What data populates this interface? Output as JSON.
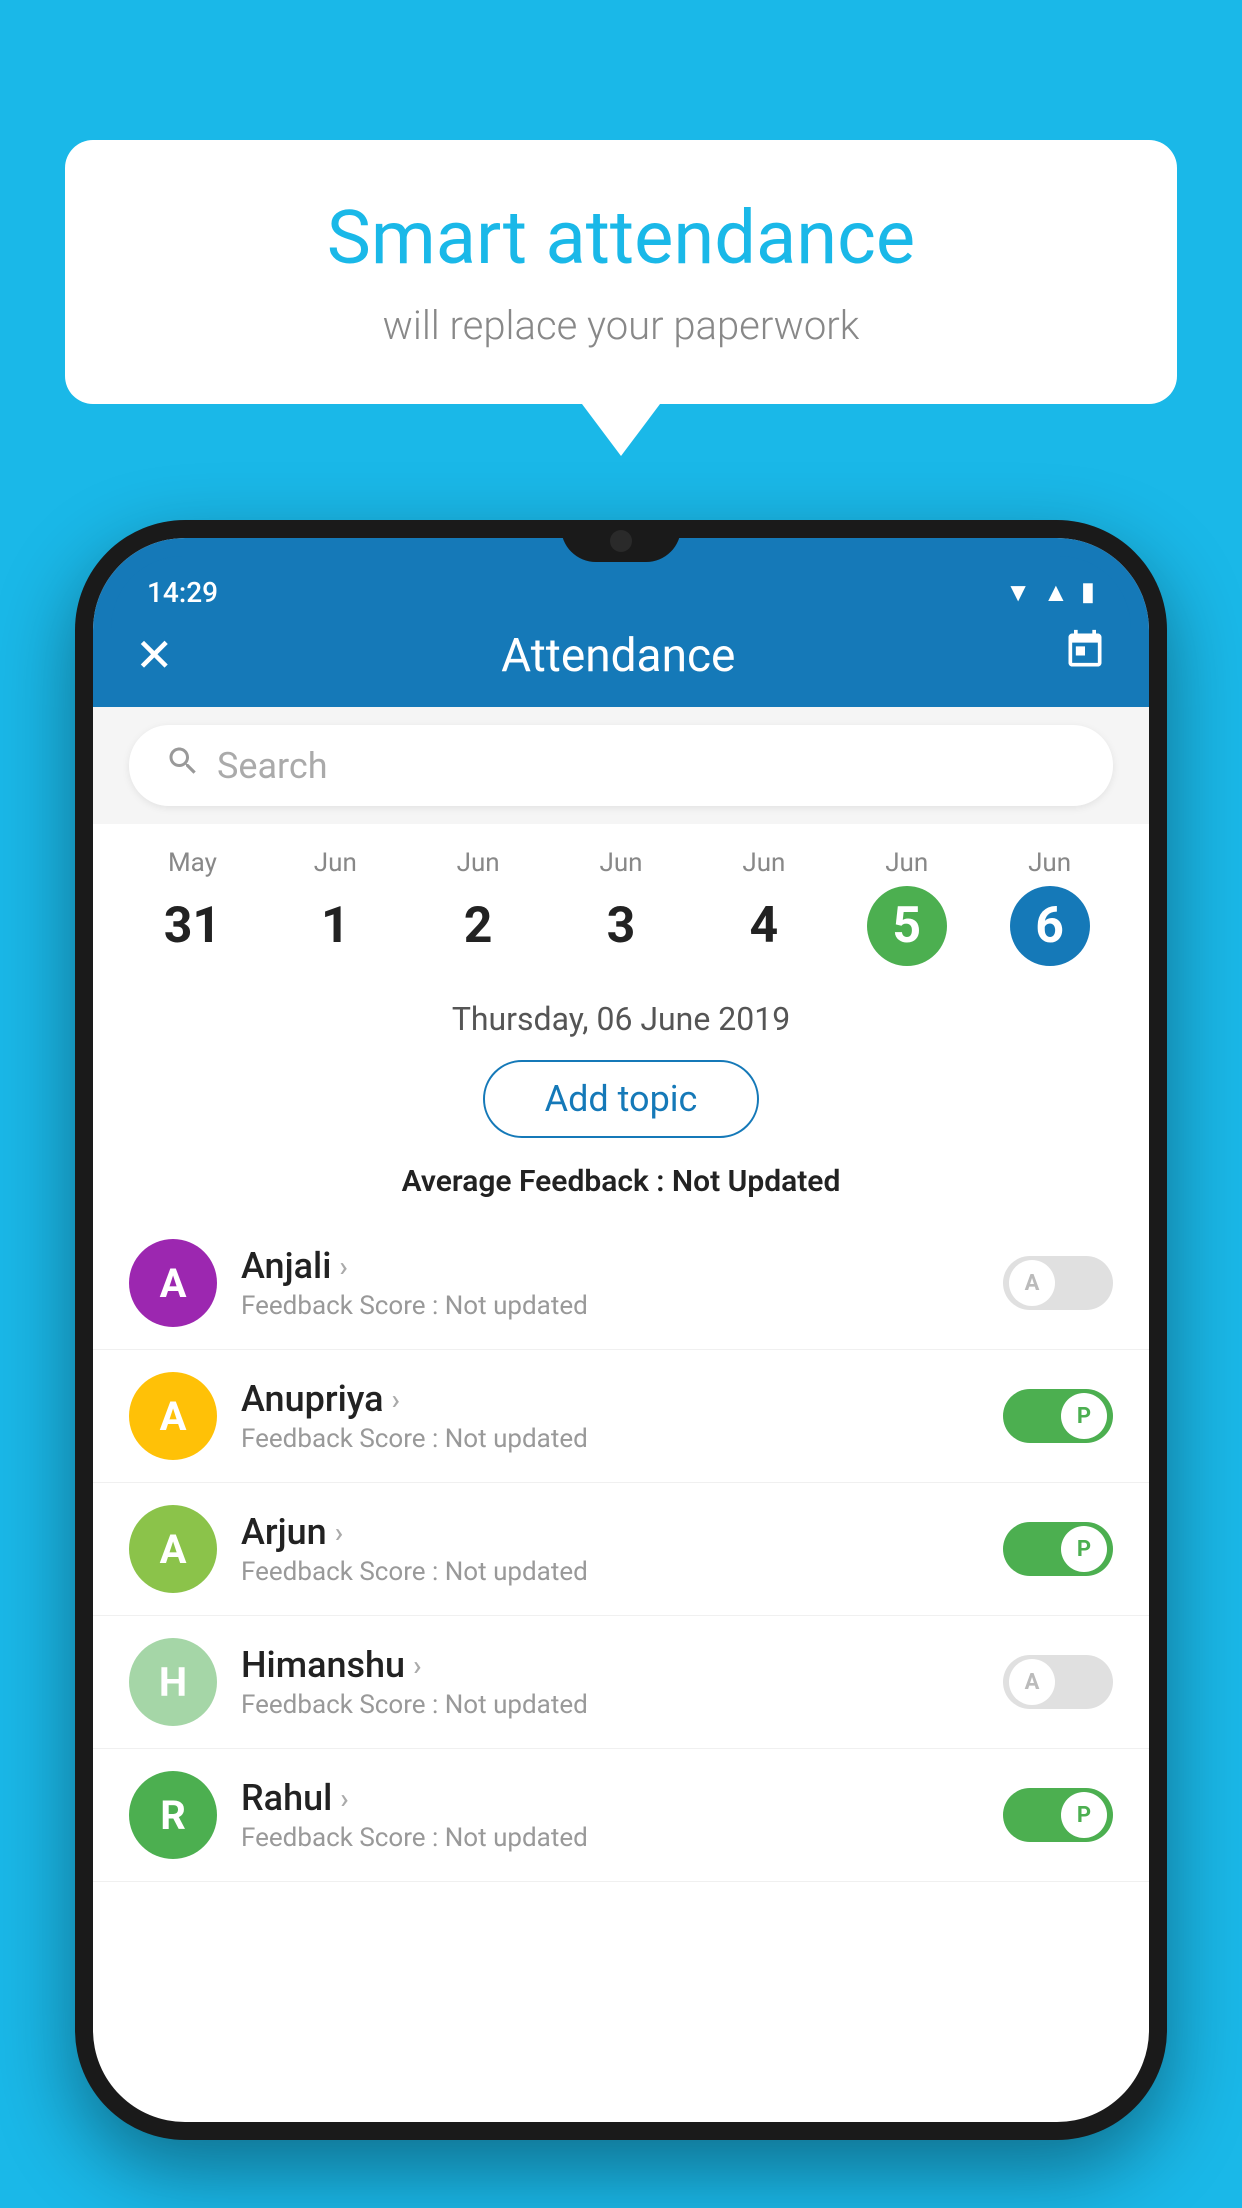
{
  "background_color": "#1ab8e8",
  "bubble": {
    "title": "Smart attendance",
    "subtitle": "will replace your paperwork"
  },
  "status_bar": {
    "time": "14:29"
  },
  "header": {
    "close_label": "✕",
    "title": "Attendance",
    "calendar_icon": "📅"
  },
  "search": {
    "placeholder": "Search"
  },
  "calendar": {
    "days": [
      {
        "month": "May",
        "date": "31",
        "state": "normal"
      },
      {
        "month": "Jun",
        "date": "1",
        "state": "normal"
      },
      {
        "month": "Jun",
        "date": "2",
        "state": "normal"
      },
      {
        "month": "Jun",
        "date": "3",
        "state": "normal"
      },
      {
        "month": "Jun",
        "date": "4",
        "state": "normal"
      },
      {
        "month": "Jun",
        "date": "5",
        "state": "today"
      },
      {
        "month": "Jun",
        "date": "6",
        "state": "selected"
      }
    ]
  },
  "selected_date": "Thursday, 06 June 2019",
  "add_topic_label": "Add topic",
  "average_feedback": {
    "label": "Average Feedback : ",
    "value": "Not Updated"
  },
  "students": [
    {
      "name": "Anjali",
      "avatar_letter": "A",
      "avatar_color": "#9c27b0",
      "feedback_label": "Feedback Score : ",
      "feedback_value": "Not updated",
      "attendance": "absent",
      "toggle_letter": "A"
    },
    {
      "name": "Anupriya",
      "avatar_letter": "A",
      "avatar_color": "#ffc107",
      "feedback_label": "Feedback Score : ",
      "feedback_value": "Not updated",
      "attendance": "present",
      "toggle_letter": "P"
    },
    {
      "name": "Arjun",
      "avatar_letter": "A",
      "avatar_color": "#8bc34a",
      "feedback_label": "Feedback Score : ",
      "feedback_value": "Not updated",
      "attendance": "present",
      "toggle_letter": "P"
    },
    {
      "name": "Himanshu",
      "avatar_letter": "H",
      "avatar_color": "#a5d6a7",
      "feedback_label": "Feedback Score : ",
      "feedback_value": "Not updated",
      "attendance": "absent",
      "toggle_letter": "A"
    },
    {
      "name": "Rahul",
      "avatar_letter": "R",
      "avatar_color": "#4caf50",
      "feedback_label": "Feedback Score : ",
      "feedback_value": "Not updated",
      "attendance": "present",
      "toggle_letter": "P"
    }
  ]
}
